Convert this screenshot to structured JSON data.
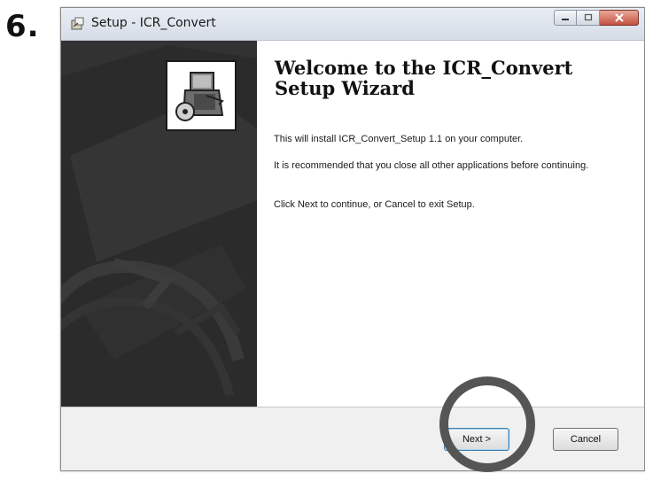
{
  "step": {
    "number": "6."
  },
  "window": {
    "title": "Setup - ICR_Convert",
    "title_icon": "setup-icon",
    "controls": [
      "minimize-icon",
      "maximize-icon",
      "close-icon"
    ]
  },
  "wizard": {
    "logo_icon": "computer-install-icon",
    "title": "Welcome to the ICR_Convert Setup Wizard",
    "paragraphs": [
      "This will install ICR_Convert_Setup 1.1 on your computer.",
      "It is recommended that you close all other applications before continuing.",
      "Click Next to continue, or Cancel to exit Setup."
    ]
  },
  "buttons": {
    "next_label": "Next >",
    "cancel_label": "Cancel"
  },
  "colors": {
    "side_panel": "#2a2a2a",
    "highlight_ring": "#555555",
    "close_button": "#c4513f"
  }
}
